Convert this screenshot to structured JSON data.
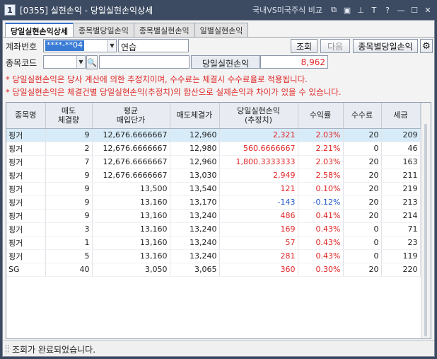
{
  "window": {
    "number": "1",
    "title": "[0355] 실현손익 - 당일실현손익상세",
    "compare_link": "국내VS미국주식 비교",
    "buttons": [
      "link-icon",
      "copy-icon",
      "pin-icon",
      "text-size-icon",
      "help-icon",
      "minimize-icon",
      "maximize-icon",
      "close-icon"
    ],
    "icon_glyphs": [
      "⧉",
      "▣",
      "⊥",
      "T",
      "?",
      "—",
      "☐",
      "✕"
    ]
  },
  "tabs": [
    {
      "label": "당일실현손익상세",
      "active": true
    },
    {
      "label": "종목별당일손익",
      "active": false
    },
    {
      "label": "종목별실현손익",
      "active": false
    },
    {
      "label": "일별실현손익",
      "active": false
    }
  ],
  "account": {
    "label": "계좌번호",
    "number": "****-**04",
    "name": "연습",
    "query_button": "조회",
    "next_button": "다음",
    "by_stock_button": "종목별당일손익"
  },
  "stock": {
    "label": "종목코드",
    "code": "",
    "name": "",
    "pnl_label": "당일실현손익",
    "pnl_value": "8,962"
  },
  "notes": [
    "* 당일실현손익은 당사 계산에 의한 추정치이며, 수수료는 체결시 수수료율로 적용됩니다.",
    "* 당일실현손익은 체결건별 당일실현손익(추정치)의 합산으로 실제손익과 차이가 있을 수 있습니다."
  ],
  "table": {
    "headers": [
      "종목명",
      "매도\n체결량",
      "평균\n매입단가",
      "매도체결가",
      "당일실현손익\n(추정치)",
      "수익률",
      "수수료",
      "세금"
    ],
    "rows": [
      {
        "name": "핑거",
        "qty": "9",
        "avg": "12,676.6666667",
        "sell": "12,960",
        "pnl": "2,321",
        "rate": "2.03%",
        "fee": "20",
        "tax": "209",
        "sign": "pos"
      },
      {
        "name": "핑거",
        "qty": "2",
        "avg": "12,676.6666667",
        "sell": "12,980",
        "pnl": "560.6666667",
        "rate": "2.21%",
        "fee": "0",
        "tax": "46",
        "sign": "pos"
      },
      {
        "name": "핑거",
        "qty": "7",
        "avg": "12,676.6666667",
        "sell": "12,960",
        "pnl": "1,800.3333333",
        "rate": "2.03%",
        "fee": "20",
        "tax": "163",
        "sign": "pos"
      },
      {
        "name": "핑거",
        "qty": "9",
        "avg": "12,676.6666667",
        "sell": "13,030",
        "pnl": "2,949",
        "rate": "2.58%",
        "fee": "20",
        "tax": "211",
        "sign": "pos"
      },
      {
        "name": "핑거",
        "qty": "9",
        "avg": "13,500",
        "sell": "13,540",
        "pnl": "121",
        "rate": "0.10%",
        "fee": "20",
        "tax": "219",
        "sign": "pos"
      },
      {
        "name": "핑거",
        "qty": "9",
        "avg": "13,160",
        "sell": "13,170",
        "pnl": "-143",
        "rate": "-0.12%",
        "fee": "20",
        "tax": "213",
        "sign": "neg"
      },
      {
        "name": "핑거",
        "qty": "9",
        "avg": "13,160",
        "sell": "13,240",
        "pnl": "486",
        "rate": "0.41%",
        "fee": "20",
        "tax": "214",
        "sign": "pos"
      },
      {
        "name": "핑거",
        "qty": "3",
        "avg": "13,160",
        "sell": "13,240",
        "pnl": "169",
        "rate": "0.43%",
        "fee": "0",
        "tax": "71",
        "sign": "pos"
      },
      {
        "name": "핑거",
        "qty": "1",
        "avg": "13,160",
        "sell": "13,240",
        "pnl": "57",
        "rate": "0.43%",
        "fee": "0",
        "tax": "23",
        "sign": "pos"
      },
      {
        "name": "핑거",
        "qty": "5",
        "avg": "13,160",
        "sell": "13,240",
        "pnl": "281",
        "rate": "0.43%",
        "fee": "0",
        "tax": "119",
        "sign": "pos"
      },
      {
        "name": "SG",
        "qty": "40",
        "avg": "3,050",
        "sell": "3,065",
        "pnl": "360",
        "rate": "0.30%",
        "fee": "20",
        "tax": "220",
        "sign": "pos"
      }
    ],
    "selected_row": 0
  },
  "status": {
    "text": "조회가 완료되었습니다."
  },
  "colors": {
    "positive": "#e02424",
    "negative": "#1f57c8",
    "selection": "#d7ecf8",
    "titlebar": "#3d4b62"
  }
}
